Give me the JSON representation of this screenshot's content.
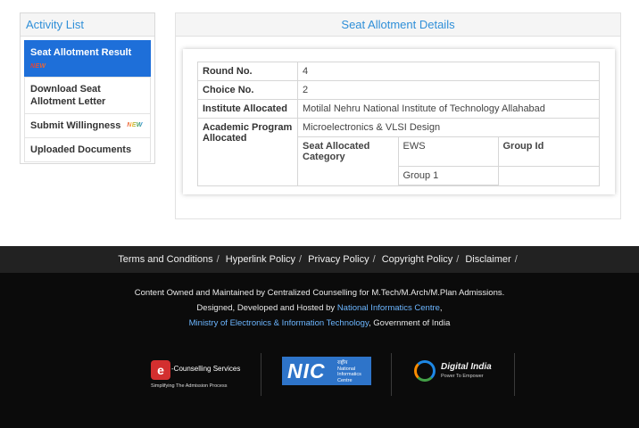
{
  "sidebar": {
    "title": "Activity List",
    "items": [
      {
        "label": "Seat Allotment Result",
        "badge": "NEW"
      },
      {
        "label": "Download Seat Allotment Letter"
      },
      {
        "label": "Submit Willingness",
        "badge": "NEW"
      },
      {
        "label": "Uploaded Documents"
      }
    ]
  },
  "panel": {
    "title": "Seat Allotment Details",
    "rows": {
      "round_label": "Round No.",
      "round_value": "4",
      "choice_label": "Choice No.",
      "choice_value": "2",
      "institute_label": "Institute Allocated",
      "institute_value": "Motilal Nehru National Institute of Technology Allahabad",
      "program_label": "Academic Program Allocated",
      "program_value": "Microelectronics & VLSI Design",
      "category_label": "Seat Allocated Category",
      "category_value": "EWS",
      "group_label": "Group Id",
      "group_value": "Group 1"
    }
  },
  "footer": {
    "links": [
      "Terms and Conditions",
      "Hyperlink Policy",
      "Privacy Policy",
      "Copyright Policy",
      "Disclaimer"
    ],
    "separator": "/",
    "line1": "Content Owned and Maintained by Centralized Counselling for M.Tech/M.Arch/M.Plan Admissions.",
    "line2_prefix": "Designed, Developed and Hosted by ",
    "line2_link": "National Informatics Centre",
    "line2_suffix": ",",
    "line3_link": "Ministry of Electronics & Information Technology",
    "line3_suffix": ", Government of India",
    "logos": {
      "cs_mark": "e",
      "cs_title": "-Counselling Services",
      "cs_sub": "Simplifying The Admission Process",
      "nic_text": "NIC",
      "nic_sub1": "राष्ट्रीय",
      "nic_sub2": "National",
      "nic_sub3": "Informatics",
      "nic_sub4": "Centre",
      "di_title": "Digital India",
      "di_tag": "Power To Empower"
    }
  },
  "colors": {
    "accent": "#2f8fd8",
    "active": "#1e6fd9",
    "footer_bar": "#222222",
    "footer_main": "#0b0b0b"
  }
}
